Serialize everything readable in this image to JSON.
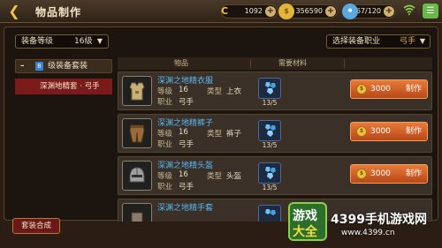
{
  "header": {
    "title": "物品制作",
    "resources": [
      {
        "icon": "coin-c-icon",
        "value": "1092"
      },
      {
        "icon": "gold-coin-icon",
        "value": "356590"
      },
      {
        "icon": "stamina-icon",
        "value": "167/120"
      }
    ]
  },
  "filters": {
    "level_label": "装备等级",
    "level_value": "16级",
    "job_label": "选择装备职业",
    "job_value": "弓手"
  },
  "category": {
    "group_label": "级装备套装",
    "group_prefix": "8",
    "selected_item": "深渊地精套 · 弓手"
  },
  "table": {
    "col_item": "物品",
    "col_material": "需要材料"
  },
  "labels": {
    "level": "等级",
    "type": "类型",
    "job": "职业",
    "craft": "制作"
  },
  "items": [
    {
      "name": "深渊之地精衣服",
      "level": "16",
      "type": "上衣",
      "job": "弓手",
      "material_count": "13/5",
      "cost": "3000"
    },
    {
      "name": "深渊之地精裤子",
      "level": "16",
      "type": "裤子",
      "job": "弓手",
      "material_count": "13/5",
      "cost": "3000"
    },
    {
      "name": "深渊之地精头盔",
      "level": "16",
      "type": "头盔",
      "job": "弓手",
      "material_count": "13/5",
      "cost": "3000"
    },
    {
      "name": "深渊之地精手套",
      "level": "",
      "type": "",
      "job": "",
      "material_count": "",
      "cost": ""
    }
  ],
  "bottom": {
    "suit_button": "套装合成"
  },
  "watermark": {
    "logo_line1": "游戏",
    "logo_line2": "大全",
    "title": "4399手机游戏网",
    "url": "www.4399.cn"
  }
}
